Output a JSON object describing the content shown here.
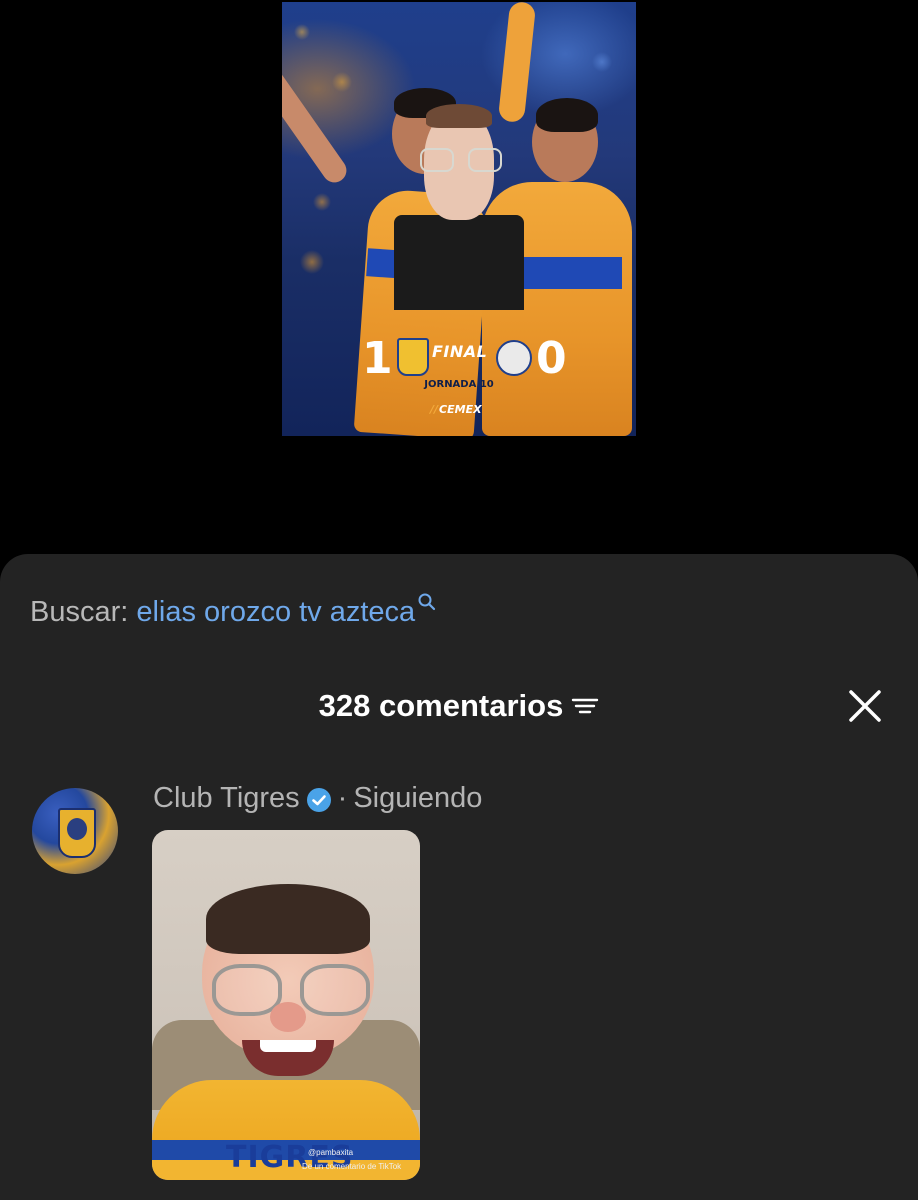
{
  "video": {
    "scoreboard": {
      "home_score": "1",
      "away_score": "0",
      "status": "FINAL",
      "round": "JORNADA 10",
      "sponsor": "CEMEX"
    }
  },
  "search": {
    "label": "Buscar:",
    "query": "elias orozco tv azteca",
    "icon": "search-icon"
  },
  "comments": {
    "title": "328 comentarios",
    "filter_icon": "filter-lines-icon",
    "close_icon": "close-icon",
    "items": [
      {
        "author": "Club Tigres",
        "verified": true,
        "separator": "·",
        "follow_status": "Siguiendo",
        "sticker": {
          "shirt_text": "TIGRES",
          "credit": "@pambaxita",
          "footer": "De un comentario de TikTok"
        }
      }
    ]
  },
  "colors": {
    "sheet_bg": "#232323",
    "search_query": "#6fa8ea",
    "verified_badge": "#4aa3e8",
    "tigres_gold": "#f2a93b",
    "tigres_blue": "#1f49b5"
  }
}
